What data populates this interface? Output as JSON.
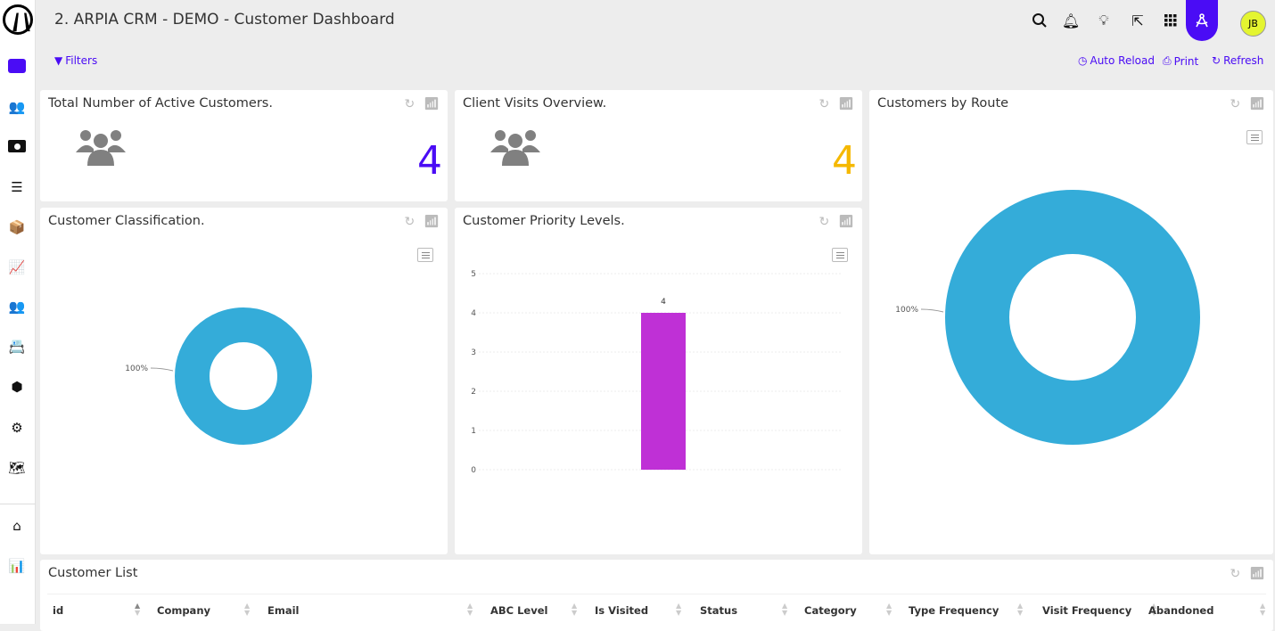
{
  "header": {
    "title": "2. ARPIA CRM - DEMO - Customer Dashboard",
    "avatar_initials": "JB",
    "icons": [
      "search-icon",
      "bell-icon",
      "lightbulb-icon",
      "share-icon",
      "apps-grid-icon",
      "compass-icon"
    ]
  },
  "sidebar": {
    "items": [
      "dashboard",
      "customers",
      "money",
      "list",
      "products",
      "charts",
      "teams",
      "contacts",
      "integrations",
      "settings",
      "map",
      "home",
      "analytics"
    ]
  },
  "toolbar": {
    "filters": "Filters",
    "auto_reload": "Auto Reload",
    "print": "Print",
    "refresh": "Refresh"
  },
  "colors": {
    "accent": "#4a0cf5",
    "gold": "#f5b800",
    "donut": "#34acd9",
    "bar": "#bf30d6"
  },
  "cards": {
    "active": {
      "title": "Total Number of Active Customers.",
      "value": "4"
    },
    "visits": {
      "title": "Client Visits Overview.",
      "value": "4"
    },
    "route": {
      "title": "Customers by Route"
    },
    "classification": {
      "title": "Customer Classification."
    },
    "priority": {
      "title": "Customer Priority Levels."
    }
  },
  "chart_data": [
    {
      "type": "pie",
      "title": "Customer Classification.",
      "donut": true,
      "slices": [
        {
          "value": 100,
          "label": "100%"
        }
      ]
    },
    {
      "type": "bar",
      "title": "Customer Priority Levels.",
      "categories": [
        ""
      ],
      "values": [
        4
      ],
      "data_labels": [
        "4"
      ],
      "ylim": [
        0,
        5
      ],
      "yticks": [
        "0",
        "1",
        "2",
        "3",
        "4",
        "5"
      ],
      "grid": true
    },
    {
      "type": "pie",
      "title": "Customers by Route",
      "donut": true,
      "slices": [
        {
          "value": 100,
          "label": "100%"
        }
      ]
    }
  ],
  "table": {
    "title": "Customer List",
    "columns": [
      "id",
      "Company",
      "Email",
      "ABC Level",
      "Is Visited",
      "Status",
      "Category",
      "Type Frequency",
      "Visit Frequency",
      "Abandoned"
    ]
  }
}
